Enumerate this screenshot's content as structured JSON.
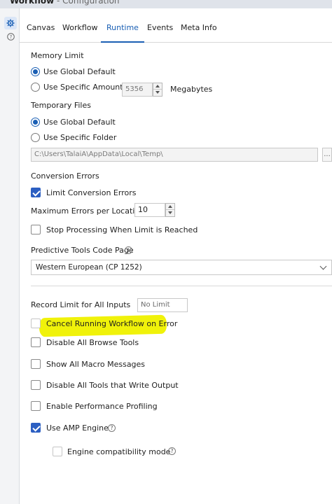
{
  "window": {
    "title": "Workflow",
    "subtitle": "- Configuration"
  },
  "rail": {
    "settings_icon": "gear-icon",
    "help_icon": "question-circle-icon"
  },
  "tabs": [
    {
      "label": "Canvas"
    },
    {
      "label": "Workflow"
    },
    {
      "label": "Runtime",
      "active": true
    },
    {
      "label": "Events"
    },
    {
      "label": "Meta Info"
    }
  ],
  "memory": {
    "heading": "Memory Limit",
    "global_label": "Use Global Default",
    "specific_label": "Use Specific Amount",
    "amount_value": "5356",
    "unit": "Megabytes"
  },
  "temp": {
    "heading": "Temporary Files",
    "global_label": "Use Global Default",
    "specific_label": "Use Specific Folder",
    "path_value": "C:\\Users\\TalaiA\\AppData\\Local\\Temp\\",
    "browse_label": "..."
  },
  "conversion": {
    "heading": "Conversion Errors",
    "limit_label": "Limit Conversion Errors",
    "max_label": "Maximum Errors per Location",
    "max_value": "10",
    "stop_label": "Stop Processing When Limit is Reached"
  },
  "predictive": {
    "label": "Predictive Tools Code Page",
    "info_icon": "info-icon",
    "selected": "Western European (CP 1252)"
  },
  "record": {
    "label": "Record Limit for All Inputs",
    "placeholder": "No Limit"
  },
  "options": {
    "cancel_label": "Cancel Running Workflow on Error",
    "disable_browse_label": "Disable All Browse Tools",
    "macro_label": "Show All Macro Messages",
    "disable_output_label": "Disable All Tools that Write Output",
    "profiling_label": "Enable Performance Profiling",
    "amp_label": "Use AMP Engine",
    "compat_label": "Engine compatibility mode"
  },
  "colors": {
    "accent": "#1a5fb4",
    "highlight": "#f0f20a"
  }
}
